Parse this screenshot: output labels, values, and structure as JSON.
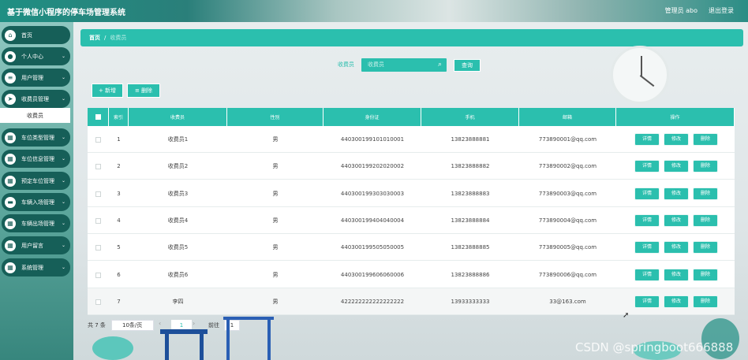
{
  "header": {
    "app_title": "基于微信小程序的停车场管理系统",
    "admin": "管理员 abo",
    "logout": "退出登录"
  },
  "sidebar": {
    "items": [
      {
        "label": "首页",
        "icon": "home-icon",
        "glyph": "⌂"
      },
      {
        "label": "个人中心",
        "icon": "user-icon",
        "glyph": "●"
      },
      {
        "label": "用户管理",
        "icon": "list-icon",
        "glyph": "≡"
      },
      {
        "label": "收费员管理",
        "icon": "send-icon",
        "glyph": "➤"
      },
      {
        "label": "车位类型管理",
        "icon": "grid-icon",
        "glyph": "▦"
      },
      {
        "label": "车位信息管理",
        "icon": "grid-icon",
        "glyph": "▦"
      },
      {
        "label": "预定车位管理",
        "icon": "grid-icon",
        "glyph": "▦"
      },
      {
        "label": "车辆入场管理",
        "icon": "car-icon",
        "glyph": "▬"
      },
      {
        "label": "车辆出场管理",
        "icon": "grid-icon",
        "glyph": "▦"
      },
      {
        "label": "用户留言",
        "icon": "grid-icon",
        "glyph": "▦"
      },
      {
        "label": "系统管理",
        "icon": "grid-icon",
        "glyph": "▦"
      }
    ],
    "sub_item": "收费员"
  },
  "breadcrumb": {
    "home": "首页",
    "separator": "/",
    "current": "收费员"
  },
  "search": {
    "label": "收费员",
    "placeholder": "收费员",
    "button": "查询"
  },
  "actions": {
    "add": "+ 新增",
    "delete": "删除"
  },
  "table": {
    "headers": [
      "",
      "索引",
      "收费员",
      "性别",
      "身份证",
      "手机",
      "邮箱",
      "操作"
    ],
    "op_labels": [
      "详情",
      "修改",
      "删除"
    ],
    "rows": [
      {
        "index": "1",
        "name": "收费员1",
        "gender": "男",
        "id_card": "440300199101010001",
        "phone": "13823888881",
        "email": "773890001@qq.com"
      },
      {
        "index": "2",
        "name": "收费员2",
        "gender": "男",
        "id_card": "440300199202020002",
        "phone": "13823888882",
        "email": "773890002@qq.com"
      },
      {
        "index": "3",
        "name": "收费员3",
        "gender": "男",
        "id_card": "440300199303030003",
        "phone": "13823888883",
        "email": "773890003@qq.com"
      },
      {
        "index": "4",
        "name": "收费员4",
        "gender": "男",
        "id_card": "440300199404040004",
        "phone": "13823888884",
        "email": "773890004@qq.com"
      },
      {
        "index": "5",
        "name": "收费员5",
        "gender": "男",
        "id_card": "440300199505050005",
        "phone": "13823888885",
        "email": "773890005@qq.com"
      },
      {
        "index": "6",
        "name": "收费员6",
        "gender": "男",
        "id_card": "440300199606060006",
        "phone": "13823888886",
        "email": "773890006@qq.com"
      },
      {
        "index": "7",
        "name": "李四",
        "gender": "男",
        "id_card": "422222222222222222",
        "phone": "13933333333",
        "email": "33@163.com"
      }
    ]
  },
  "pagination": {
    "total": "共 7 条",
    "page_size": "10条/页",
    "current_page": "1",
    "goto_label": "前往",
    "goto_value": "1",
    "prev": "‹",
    "next": "›"
  },
  "watermark": "CSDN @springboot666888",
  "colors": {
    "accent": "#2bbfae",
    "menu_bg": "#165f58"
  }
}
